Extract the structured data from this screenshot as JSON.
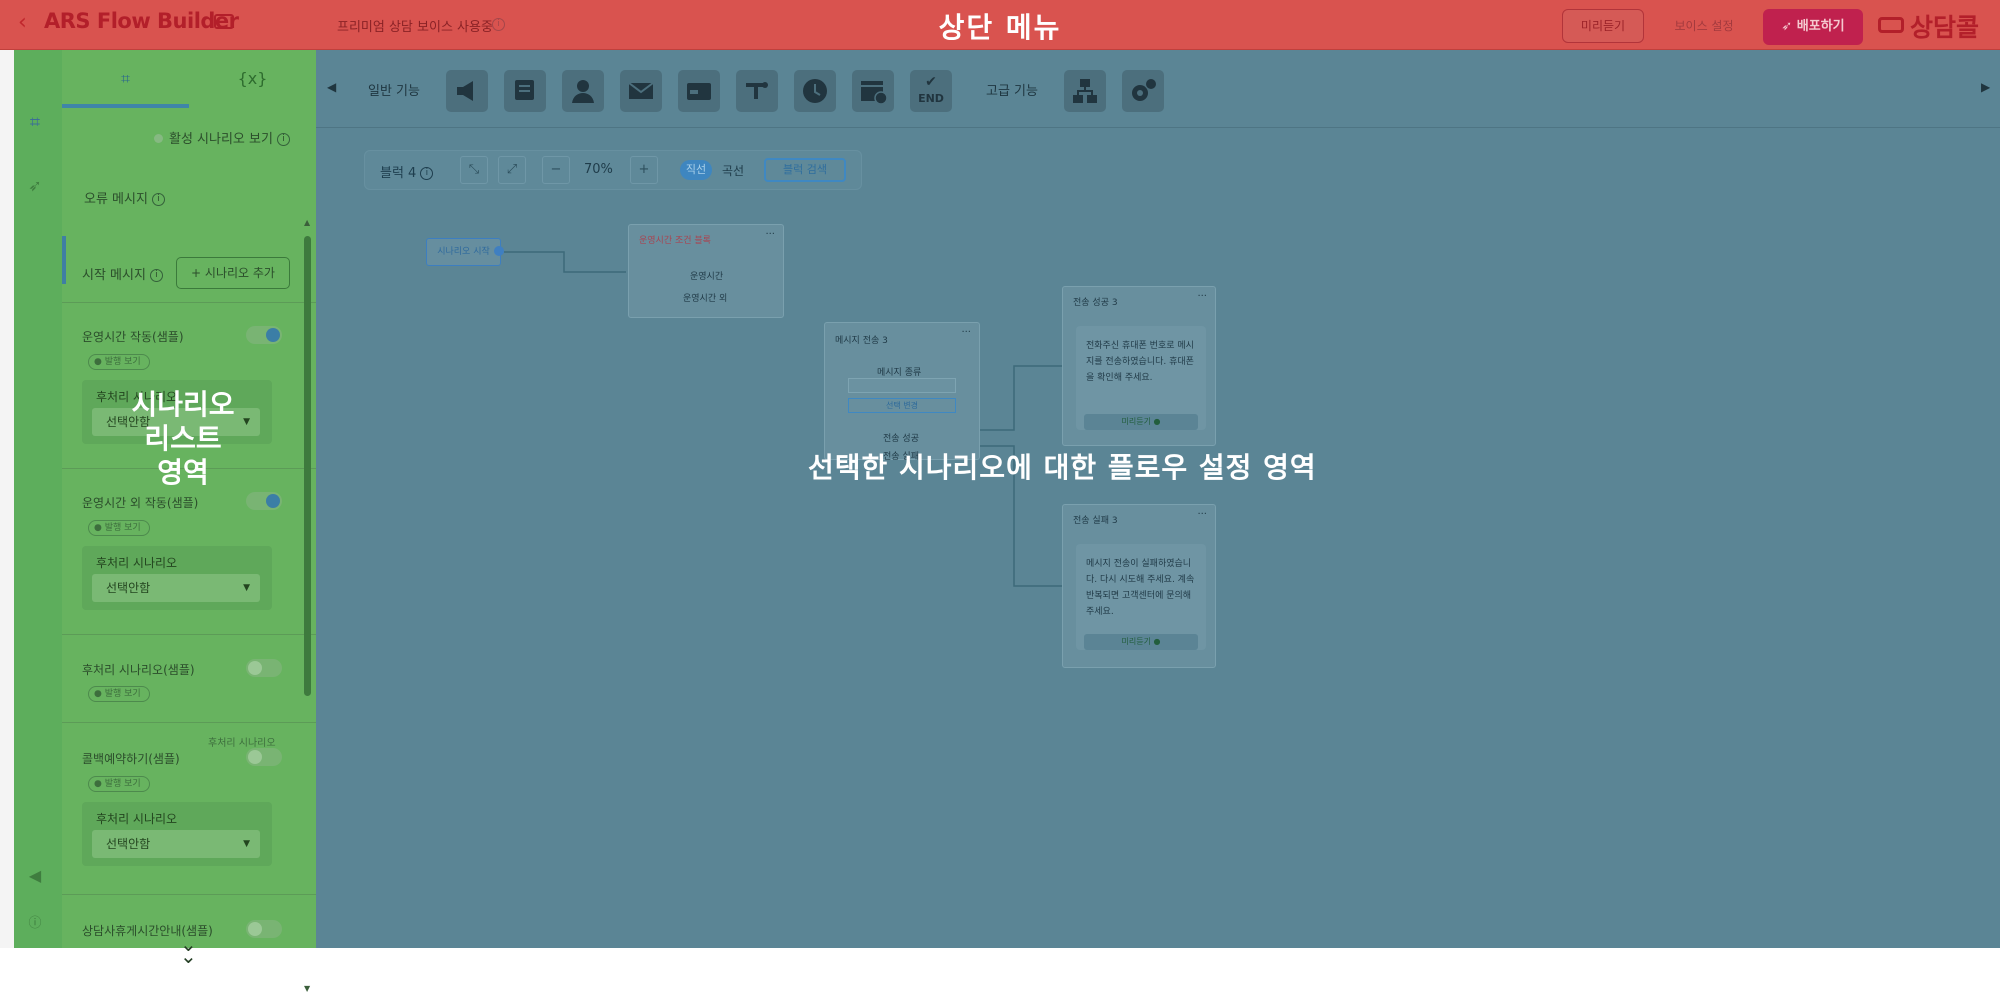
{
  "header": {
    "back": "‹",
    "app_title": "ARS Flow Builder",
    "plan_text": "프리미엄 상담 보이스 사용중",
    "overlay": "상단 메뉴",
    "preview": "미리듣기",
    "voice_settings": "보이스 설정",
    "deploy": "배포하기",
    "brand": "상담콜"
  },
  "sidebar": {
    "tab_flow_icon": "flow-icon",
    "tab_var": "{x}",
    "active_toggle": "활성 시나리오 보기",
    "error_message": "오류 메시지",
    "start_message": "시작 메시지",
    "add_scenario": "+ 시나리오 추가",
    "overlay_line1": "시나리오",
    "overlay_line2": "리스트",
    "overlay_line3": "영역",
    "scenarios": [
      {
        "title": "운영시간 작동(샘플)",
        "toggle": "on",
        "view": "발행 보기",
        "post_label": "후처리 시나리오",
        "post_value": "선택안함"
      },
      {
        "title": "운영시간 외 작동(샘플)",
        "toggle": "on",
        "view": "발행 보기",
        "post_label": "후처리 시나리오",
        "post_value": "선택안함"
      },
      {
        "title": "후처리 시나리오(샘플)",
        "toggle": "off",
        "view": "발행 보기",
        "tag": "후처리 시나리오"
      },
      {
        "title": "콜백예약하기(샘플)",
        "toggle": "off",
        "view": "발행 보기",
        "post_label": "후처리 시나리오",
        "post_value": "선택안함"
      },
      {
        "title": "상담사휴게시간안내(샘플)",
        "toggle": "off"
      }
    ]
  },
  "toolbar": {
    "general": "일반 기능",
    "advanced": "고급 기능",
    "end": "END",
    "tools": [
      "megaphone-icon",
      "message-icon",
      "agent-icon",
      "mail-icon",
      "card-icon",
      "branch-icon",
      "clock-icon",
      "calendar-icon",
      "end-icon"
    ],
    "advanced_tools": [
      "org-chart-icon",
      "settings-gear-icon"
    ]
  },
  "canvas_controls": {
    "blocks_label": "블럭 4",
    "zoom": "70%",
    "straight": "직선",
    "curve": "곡선",
    "search": "블럭 검색"
  },
  "canvas": {
    "overlay": "선택한 시나리오에 대한 플로우 설정 영역",
    "start_node": "시나리오 시작",
    "hours_node_title": "운영시간 조건 블록",
    "hours_in": "운영시간",
    "hours_out": "운영시간 외",
    "send_node_title": "메시지 전송 3",
    "send_kind": "메시지 종류",
    "send_note": "선택",
    "send_edit": "선택 변경",
    "send_ok": "전송 성공",
    "send_fail": "전송 실패",
    "ok_node_title": "전송 성공 3",
    "ok_text": "전화주신 휴대폰 번호로 메시지를 전송하였습니다. 휴대폰을 확인해 주세요.",
    "fail_node_title": "전송 실패 3",
    "fail_text": "메시지 전송이 실패하였습니다. 다시 시도해 주세요. 계속 반복되면 고객센터에 문의해 주세요.",
    "preview_small": "미리듣기"
  },
  "colors": {
    "header_red": "#d9534f",
    "panel_green": "#67b35f",
    "canvas": "#5b8595",
    "deploy": "#c0214e"
  }
}
